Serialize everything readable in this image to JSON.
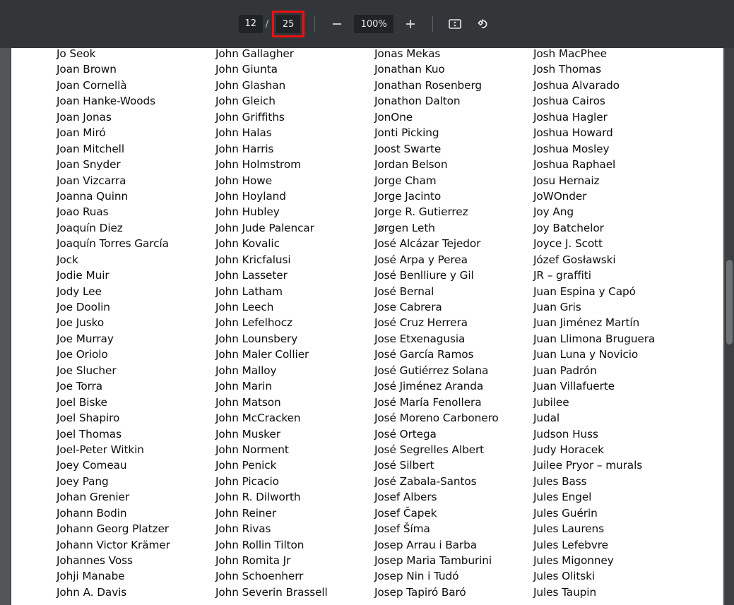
{
  "toolbar": {
    "page_current": "12",
    "page_separator": "/",
    "page_total": "25",
    "page_total_highlighted": true,
    "highlight_color": "#ee1111",
    "zoom_out_label": "−",
    "zoom_value": "100%",
    "zoom_in_label": "+",
    "fit_page_icon": "fit-to-page-icon",
    "rotate_icon": "rotate-clockwise-icon",
    "background_color": "#323639",
    "field_color": "#1f2326",
    "text_color": "#e8eaed"
  },
  "document": {
    "page_background": "#ffffff",
    "viewer_background": "#525659",
    "columns": [
      {
        "name": "column-1",
        "names": [
          "Jo Seok",
          "Joan Brown",
          "Joan Cornellà",
          "Joan Hanke-Woods",
          "Joan Jonas",
          "Joan Miró",
          "Joan Mitchell",
          "Joan Snyder",
          "Joan Vizcarra",
          "Joanna Quinn",
          "Joao Ruas",
          "Joaquín Diez",
          "Joaquín Torres García",
          "Jock",
          "Jodie Muir",
          "Jody Lee",
          "Joe Doolin",
          "Joe Jusko",
          "Joe Murray",
          "Joe Oriolo",
          "Joe Slucher",
          "Joe Torra",
          "Joel Biske",
          "Joel Shapiro",
          "Joel Thomas",
          "Joel-Peter Witkin",
          "Joey Comeau",
          "Joey Pang",
          "Johan Grenier",
          "Johann Bodin",
          "Johann Georg Platzer",
          "Johann Victor Krämer",
          "Johannes Voss",
          "Johji Manabe",
          "John A. Davis"
        ]
      },
      {
        "name": "column-2",
        "names": [
          "John Gallagher",
          "John Giunta",
          "John Glashan",
          "John Gleich",
          "John Griffiths",
          "John Halas",
          "John Harris",
          "John Holmstrom",
          "John Howe",
          "John Hoyland",
          "John Hubley",
          "John Jude Palencar",
          "John Kovalic",
          "John Kricfalusi",
          "John Lasseter",
          "John Latham",
          "John Leech",
          "John Lefelhocz",
          "John Lounsbery",
          "John Maler Collier",
          "John Malloy",
          "John Marin",
          "John Matson",
          "John McCracken",
          "John Musker",
          "John Norment",
          "John Penick",
          "John Picacio",
          "John R. Dilworth",
          "John Reiner",
          "John Rivas",
          "John Rollin Tilton",
          "John Romita Jr",
          "John Schoenherr",
          "John Severin Brassell"
        ]
      },
      {
        "name": "column-3",
        "names": [
          "Jonas Mekas",
          "Jonathan Kuo",
          "Jonathan Rosenberg",
          "Jonathon Dalton",
          "JonOne",
          "Jonti Picking",
          "Joost Swarte",
          "Jordan Belson",
          "Jorge Cham",
          "Jorge Jacinto",
          "Jorge R. Gutierrez",
          "Jørgen Leth",
          "José Alcázar Tejedor",
          "José Arpa y Perea",
          "José Benlliure y Gil",
          "José Bernal",
          "Jose Cabrera",
          "José Cruz Herrera",
          "Jose Etxenagusia",
          "José García Ramos",
          "José Gutiérrez Solana",
          "José Jiménez Aranda",
          "José María Fenollera",
          "José Moreno Carbonero",
          "José Ortega",
          "José Segrelles Albert",
          "José Silbert",
          "José Zabala-Santos",
          "Josef Albers",
          "Josef Čapek",
          "Josef Šíma",
          "Josep Arrau i Barba",
          "Josep Maria Tamburini",
          "Josep Nin i Tudó",
          "Josep Tapiró Baró"
        ]
      },
      {
        "name": "column-4",
        "names": [
          "Josh MacPhee",
          "Josh Thomas",
          "Joshua Alvarado",
          "Joshua Cairos",
          "Joshua Hagler",
          "Joshua Howard",
          "Joshua Mosley",
          "Joshua Raphael",
          "Josu Hernaiz",
          "JoWOnder",
          "Joy Ang",
          "Joy Batchelor",
          "Joyce J. Scott",
          "Józef Gosławski",
          "JR – graffiti",
          "Juan Espina y Capó",
          "Juan Gris",
          "Juan Jiménez Martín",
          "Juan Llimona Bruguera",
          "Juan Luna y Novicio",
          "Juan Padrón",
          "Juan Villafuerte",
          "Jubilee",
          "Judal",
          "Judson Huss",
          "Judy Horacek",
          "Juilee Pryor – murals",
          "Jules Bass",
          "Jules Engel",
          "Jules Guérin",
          "Jules Laurens",
          "Jules Lefebvre",
          "Jules Migonney",
          "Jules Olitski",
          "Jules Taupin"
        ]
      }
    ]
  }
}
